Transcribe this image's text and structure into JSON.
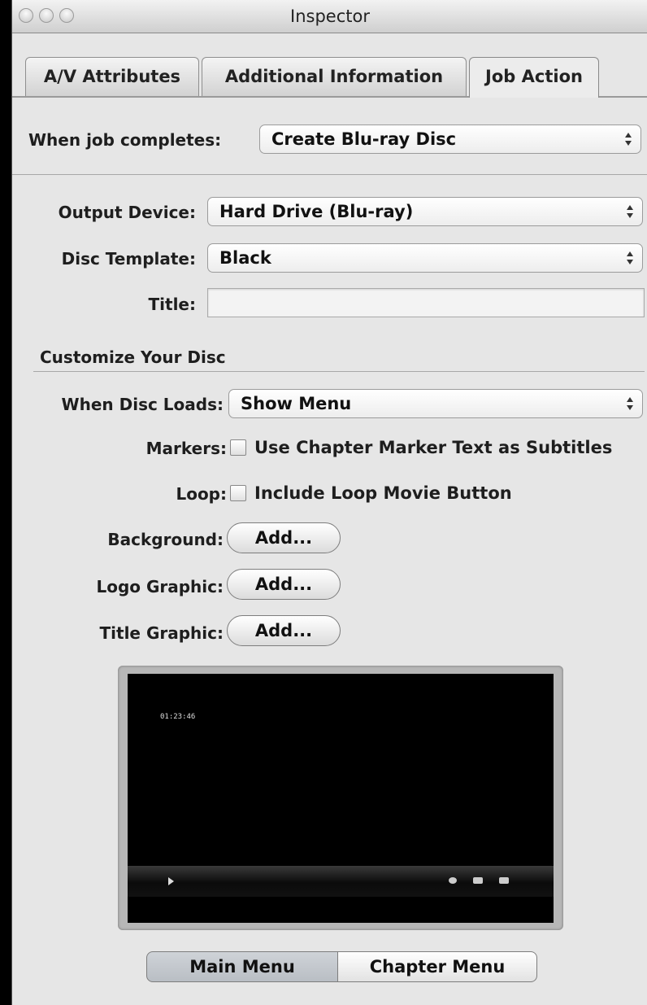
{
  "window": {
    "title": "Inspector"
  },
  "tabs": [
    {
      "label": "A/V Attributes",
      "active": false
    },
    {
      "label": "Additional Information",
      "active": false
    },
    {
      "label": "Job Action",
      "active": true
    }
  ],
  "job": {
    "label": "When job completes:",
    "value": "Create Blu-ray Disc"
  },
  "output_device": {
    "label": "Output Device:",
    "value": "Hard Drive (Blu-ray)"
  },
  "disc_template": {
    "label": "Disc Template:",
    "value": "Black"
  },
  "title_field": {
    "label": "Title:",
    "value": ""
  },
  "customize": {
    "heading": "Customize Your Disc"
  },
  "disc_loads": {
    "label": "When Disc Loads:",
    "value": "Show Menu"
  },
  "markers": {
    "label": "Markers:",
    "checkbox_label": "Use Chapter Marker Text as Subtitles",
    "checked": false
  },
  "loop": {
    "label": "Loop:",
    "checkbox_label": "Include Loop Movie Button",
    "checked": false
  },
  "background": {
    "label": "Background:",
    "button": "Add..."
  },
  "logo_graphic": {
    "label": "Logo Graphic:",
    "button": "Add..."
  },
  "title_graphic": {
    "label": "Title Graphic:",
    "button": "Add..."
  },
  "preview": {
    "timecode": "01:23:46"
  },
  "menu_switch": {
    "main": "Main Menu",
    "chapter": "Chapter Menu",
    "selected": "Main Menu"
  }
}
